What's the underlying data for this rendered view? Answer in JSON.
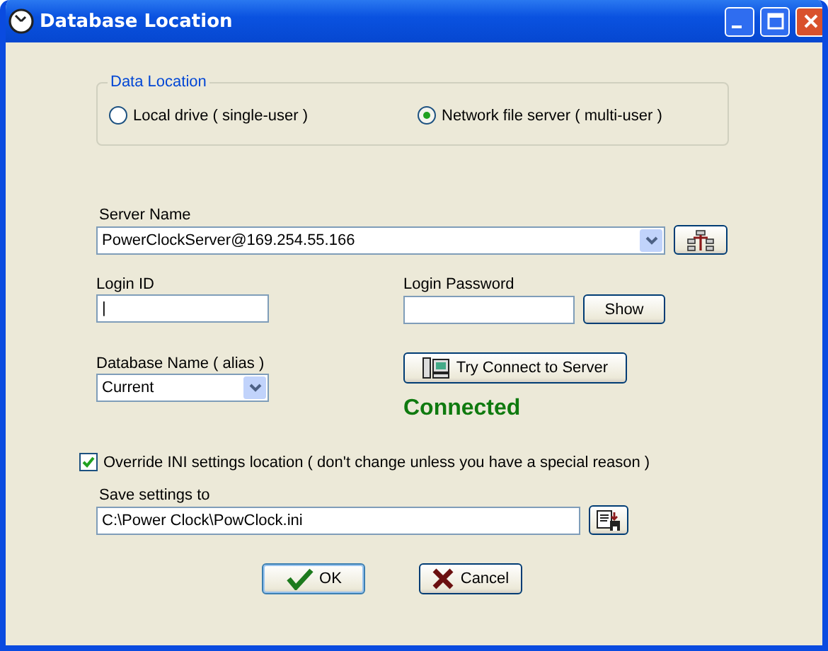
{
  "window": {
    "title": "Database Location"
  },
  "data_location": {
    "legend": "Data Location",
    "options": [
      {
        "label": "Local drive ( single-user )",
        "selected": false
      },
      {
        "label": "Network file server ( multi-user )",
        "selected": true
      }
    ]
  },
  "server_name": {
    "label": "Server Name",
    "value": "PowerClockServer@169.254.55.166"
  },
  "login_id": {
    "label": "Login ID",
    "value": "|"
  },
  "login_password": {
    "label": "Login Password",
    "button": "Show"
  },
  "database_name": {
    "label": "Database Name ( alias )",
    "value": "Current"
  },
  "connect_button": "Try Connect to Server",
  "status": "Connected",
  "override": {
    "label": "Override INI settings location ( don't change unless you have a special reason )",
    "checked": true
  },
  "save_settings": {
    "label": "Save settings to",
    "value": "C:\\Power Clock\\PowClock.ini"
  },
  "buttons": [
    {
      "kind": "ok",
      "label": "OK"
    },
    {
      "kind": "cancel",
      "label": "Cancel"
    }
  ]
}
